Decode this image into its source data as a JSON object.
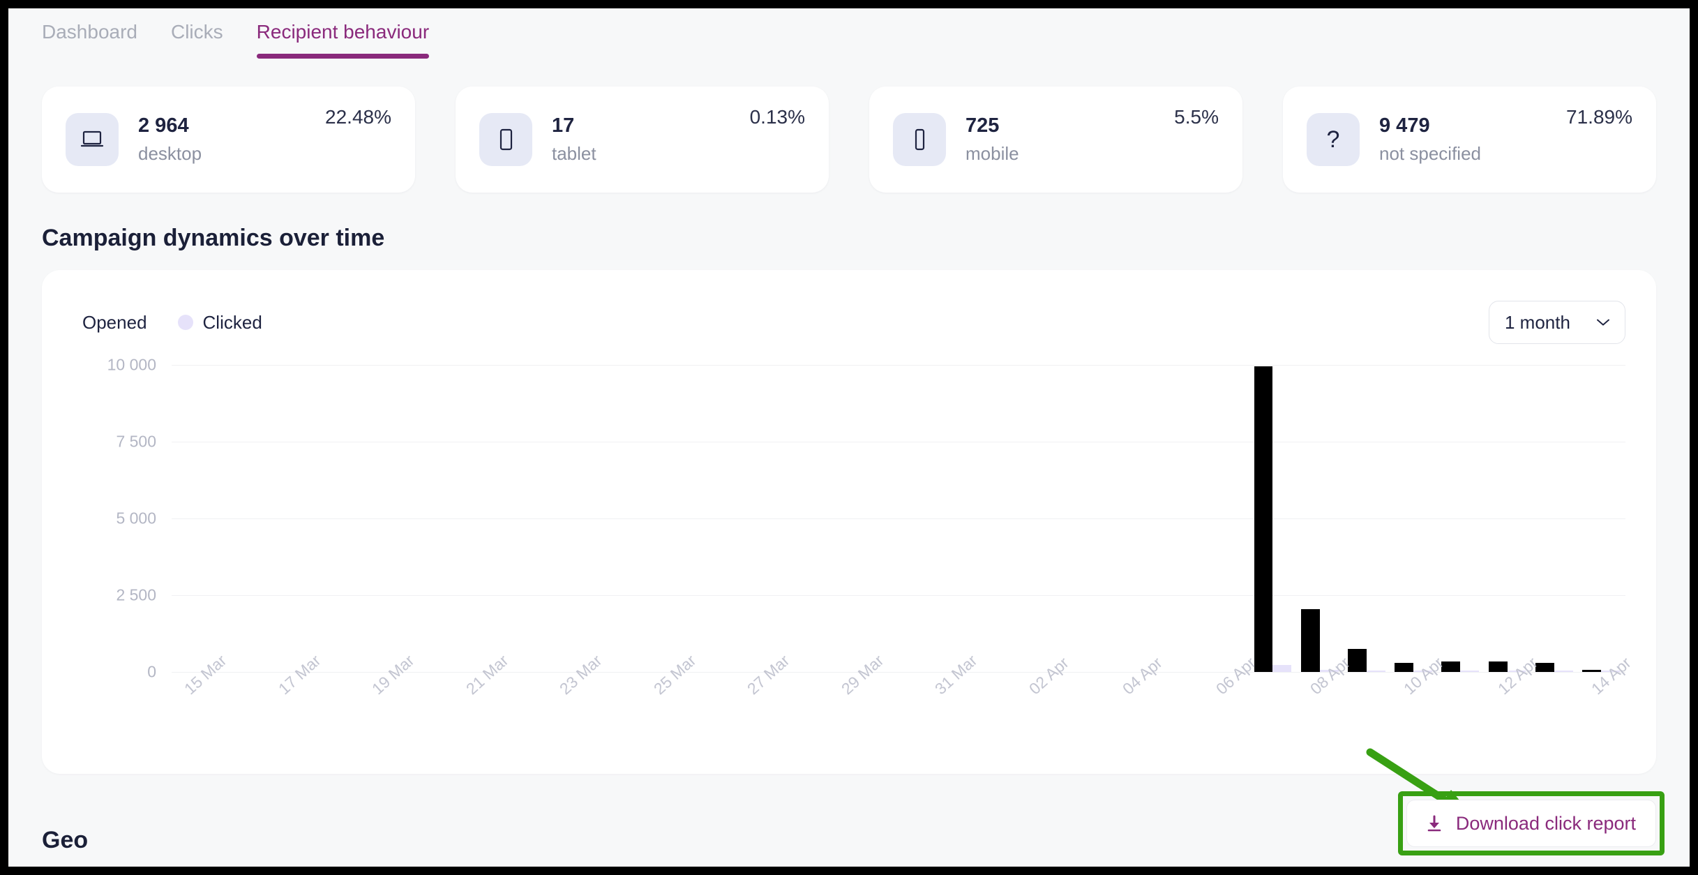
{
  "tabs": [
    {
      "label": "Dashboard",
      "active": false
    },
    {
      "label": "Clicks",
      "active": false
    },
    {
      "label": "Recipient behaviour",
      "active": true
    }
  ],
  "stat_cards": [
    {
      "icon": "laptop-icon",
      "value": "2 964",
      "label": "desktop",
      "percent": "22.48%"
    },
    {
      "icon": "tablet-icon",
      "value": "17",
      "label": "tablet",
      "percent": "0.13%"
    },
    {
      "icon": "mobile-icon",
      "value": "725",
      "label": "mobile",
      "percent": "5.5%"
    },
    {
      "icon": "question-mark-icon",
      "value": "9 479",
      "label": "not specified",
      "percent": "71.89%"
    }
  ],
  "campaign_section": {
    "title": "Campaign dynamics over time",
    "period_selector": {
      "value": "1 month",
      "icon": "chevron-down-icon"
    }
  },
  "geo_section": {
    "title": "Geo"
  },
  "download": {
    "label": "Download click report",
    "icon": "download-icon"
  },
  "colors": {
    "accent_purple": "#8a2a7c",
    "opened_bar": "#000000",
    "clicked_bar": "#e6e2fa",
    "highlight_green": "#38a013",
    "page_bg": "#f7f8f9",
    "card_bg": "#ffffff",
    "icon_tile": "#e6e9f5"
  },
  "chart_data": {
    "type": "bar",
    "title": "Campaign dynamics over time",
    "xlabel": "",
    "ylabel": "",
    "ylim": [
      0,
      10000
    ],
    "yticks": [
      0,
      2500,
      5000,
      7500,
      10000
    ],
    "ytick_labels": [
      "0",
      "2 500",
      "5 000",
      "7 500",
      "10 000"
    ],
    "grid": true,
    "legend_position": "top-left",
    "x_tick_labels": [
      "15 Mar",
      "17 Mar",
      "19 Mar",
      "21 Mar",
      "23 Mar",
      "25 Mar",
      "27 Mar",
      "29 Mar",
      "31 Mar",
      "02 Apr",
      "04 Apr",
      "06 Apr",
      "08 Apr",
      "10 Apr",
      "12 Apr",
      "14 Apr"
    ],
    "categories": [
      "15 Mar",
      "16 Mar",
      "17 Mar",
      "18 Mar",
      "19 Mar",
      "20 Mar",
      "21 Mar",
      "22 Mar",
      "23 Mar",
      "24 Mar",
      "25 Mar",
      "26 Mar",
      "27 Mar",
      "28 Mar",
      "29 Mar",
      "30 Mar",
      "31 Mar",
      "01 Apr",
      "02 Apr",
      "03 Apr",
      "04 Apr",
      "05 Apr",
      "06 Apr",
      "07 Apr",
      "08 Apr",
      "09 Apr",
      "10 Apr",
      "11 Apr",
      "12 Apr",
      "13 Apr",
      "14 Apr"
    ],
    "series": [
      {
        "name": "Opened",
        "color": "#000000",
        "values": [
          0,
          0,
          0,
          0,
          0,
          0,
          0,
          0,
          0,
          0,
          0,
          0,
          0,
          0,
          0,
          0,
          0,
          0,
          0,
          0,
          0,
          0,
          0,
          9950,
          2050,
          760,
          300,
          350,
          330,
          300,
          60
        ]
      },
      {
        "name": "Clicked",
        "color": "#e6e2fa",
        "values": [
          0,
          0,
          0,
          0,
          0,
          0,
          0,
          0,
          0,
          0,
          0,
          0,
          0,
          0,
          0,
          0,
          0,
          0,
          0,
          0,
          0,
          0,
          0,
          230,
          60,
          40,
          30,
          30,
          30,
          20,
          10
        ]
      }
    ]
  }
}
